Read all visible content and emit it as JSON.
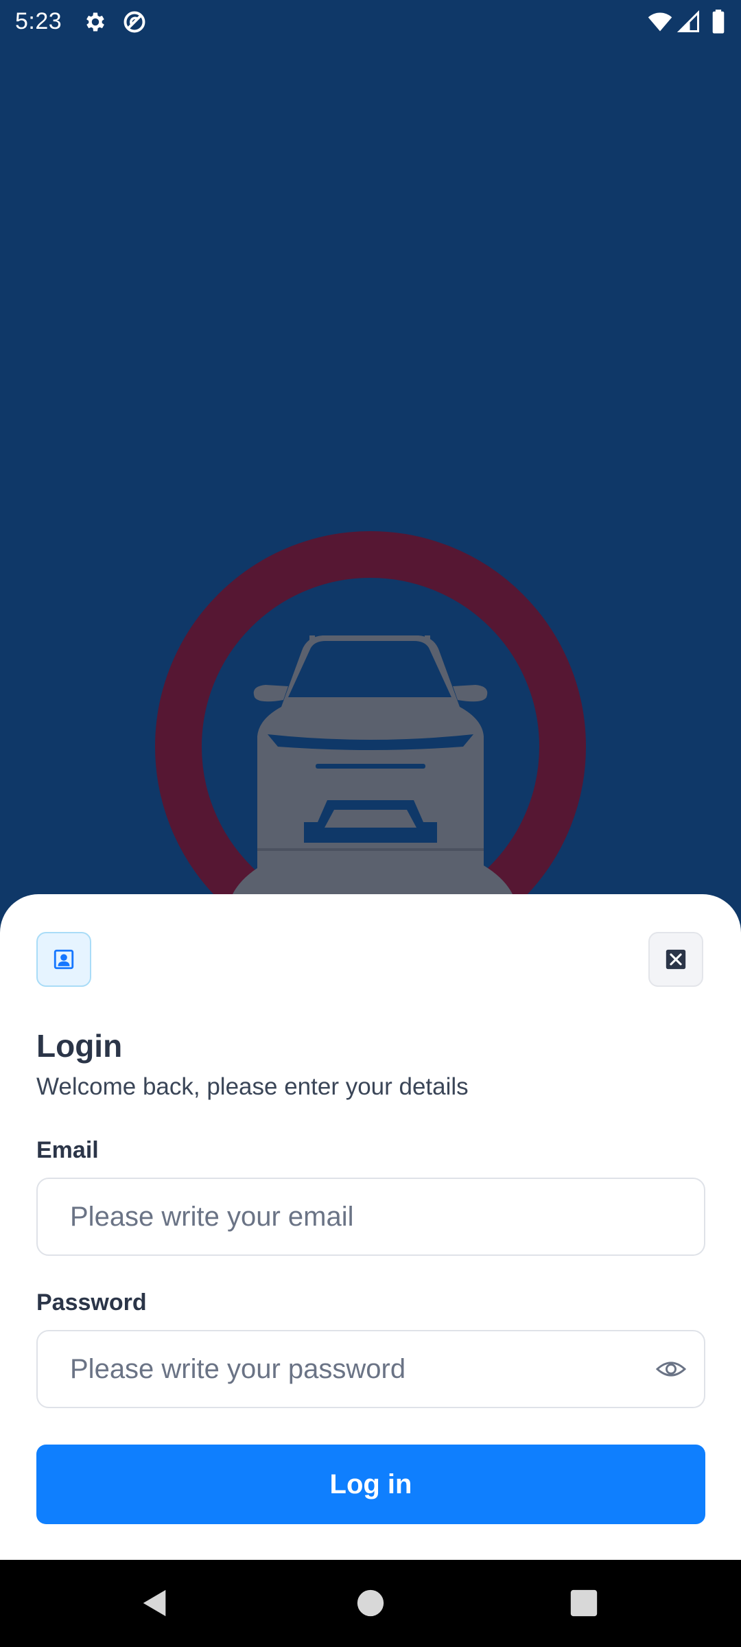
{
  "status_bar": {
    "time": "5:23",
    "icons": [
      "settings-icon",
      "do-not-disturb-icon",
      "wifi-icon",
      "cell-signal-icon",
      "battery-icon"
    ]
  },
  "hero": {
    "icon": "car-in-circle-icon",
    "colors": {
      "background": "#0f3868",
      "ring": "#561733",
      "car": "#5b616e"
    }
  },
  "sheet": {
    "profile_icon": "profile-picture-icon",
    "close_icon": "close-icon",
    "title": "Login",
    "subtitle": "Welcome back, please enter your details",
    "email": {
      "label": "Email",
      "placeholder": "Please write your email",
      "value": ""
    },
    "password": {
      "label": "Password",
      "placeholder": "Please write your password",
      "value": "",
      "toggle_icon": "eye-icon"
    },
    "login_button": "Log in",
    "accent_color": "#0f7ffe"
  },
  "nav_bar": {
    "icons": [
      "back-icon",
      "home-icon",
      "recents-icon"
    ]
  }
}
